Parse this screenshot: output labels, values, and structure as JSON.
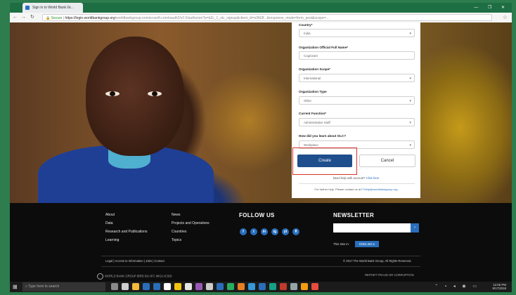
{
  "browser": {
    "tab_title": "Sign in to World Bank Gr...",
    "window_controls": "— ❐ ✕",
    "url_secure": "Secure",
    "url_host": "https://login.worldbankgroup.org",
    "url_path": "/worldbankgroup.onmicrosoft.com/oauth2/v2.0/authorize?p=b2c_1_olc_signup&client_id=e2fd3f...&response_mode=form_post&scope=..."
  },
  "form": {
    "fields": [
      {
        "label": "Country*",
        "value": "India"
      },
      {
        "label": "Organization Official Full Name*",
        "value": "Cognizant"
      },
      {
        "label": "Organization Scope*",
        "value": "International"
      },
      {
        "label": "Organization Type",
        "value": "Other"
      },
      {
        "label": "Current Function*",
        "value": "Administrative Staff"
      },
      {
        "label": "How did you learn about OLC?",
        "value": "Workplace"
      }
    ],
    "create_label": "Create",
    "cancel_label": "Cancel",
    "help_text": "Need help with account?",
    "help_link": "Click here",
    "contact_text": "For further help, Please contact us at",
    "contact_email": "ITHelp@worldbankgroup.org"
  },
  "footer": {
    "col1": [
      "About",
      "Data",
      "Research and Publications",
      "Learning"
    ],
    "col2": [
      "News",
      "Projects and Operations",
      "Countries",
      "Topics"
    ],
    "follow_title": "FOLLOW US",
    "social": [
      "f",
      "t",
      "in",
      "ig",
      "yt",
      "fl"
    ],
    "newsletter_title": "NEWSLETTER",
    "newsletter_go": "›",
    "site_in_label": "This Site in:",
    "language": "ENGLISH ▾",
    "legal": "Legal  |  Access to Information  |  Jobs  |  Contact",
    "copyright": "© 2017 The World Bank Group, All Rights Reserved.",
    "wbg": "WORLD BANK GROUP   IBRD   IDA   IFC   MIGA   ICSID",
    "fraud": "REPORT FRAUD OR CORRUPTION"
  },
  "taskbar": {
    "search_placeholder": "Type here to search",
    "time": "12:05 PM",
    "date": "8/17/2018",
    "app_colors": [
      "#8a8a8a",
      "#cfcfcf",
      "#f6b93b",
      "#2a6ebb",
      "#2a6ebb",
      "#ffffff",
      "#f1c40f",
      "#e6e6e6",
      "#9b59b6",
      "#cccccc",
      "#2a6ebb",
      "#27ae60",
      "#e67e22",
      "#3498db",
      "#2a6ebb",
      "#16a085",
      "#c0392b",
      "#95a5a6",
      "#f39c12",
      "#e74c3c"
    ]
  }
}
